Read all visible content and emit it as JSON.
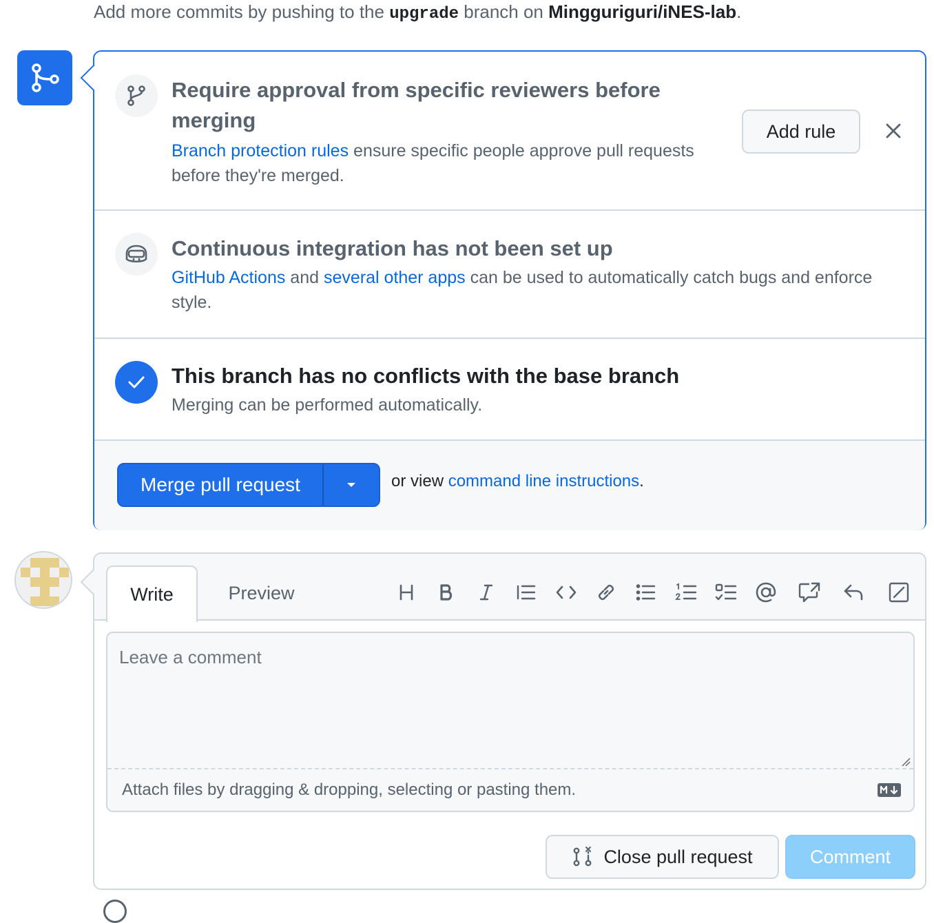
{
  "top_note": {
    "prefix": "Add more commits by pushing to the ",
    "branch": "upgrade",
    "middle": " branch on ",
    "repo": "Mingguriguri/iNES-lab",
    "suffix": "."
  },
  "merge_panel": {
    "approval": {
      "title": "Require approval from specific reviewers before merging",
      "link": "Branch protection rules",
      "desc": " ensure specific people approve pull requests before they're merged.",
      "add_rule_label": "Add rule"
    },
    "ci": {
      "title": "Continuous integration has not been set up",
      "link1": "GitHub Actions",
      "and": " and ",
      "link2": "several other apps",
      "desc": " can be used to automatically catch bugs and enforce style."
    },
    "conflicts": {
      "title": "This branch has no conflicts with the base branch",
      "desc": "Merging can be performed automatically."
    },
    "merge": {
      "button_label": "Merge pull request",
      "or_view": "or view ",
      "cmd_link": "command line instructions",
      "suffix": "."
    }
  },
  "comment_form": {
    "tabs": [
      "Write",
      "Preview"
    ],
    "toolbar": [
      "heading-icon",
      "bold-icon",
      "italic-icon",
      "quote-icon",
      "code-icon",
      "link-icon",
      "unordered-list-icon",
      "ordered-list-icon",
      "task-list-icon",
      "mention-icon",
      "cross-reference-icon",
      "saved-replies-icon",
      "fullscreen-icon"
    ],
    "placeholder": "Leave a comment",
    "attach_text": "Attach files by dragging & dropping, selecting or pasting them.",
    "close_pr_label": "Close pull request",
    "comment_label": "Comment"
  },
  "colors": {
    "accent": "#1f6feb",
    "link": "#0969da",
    "comment_disabled": "#8ccffb"
  }
}
